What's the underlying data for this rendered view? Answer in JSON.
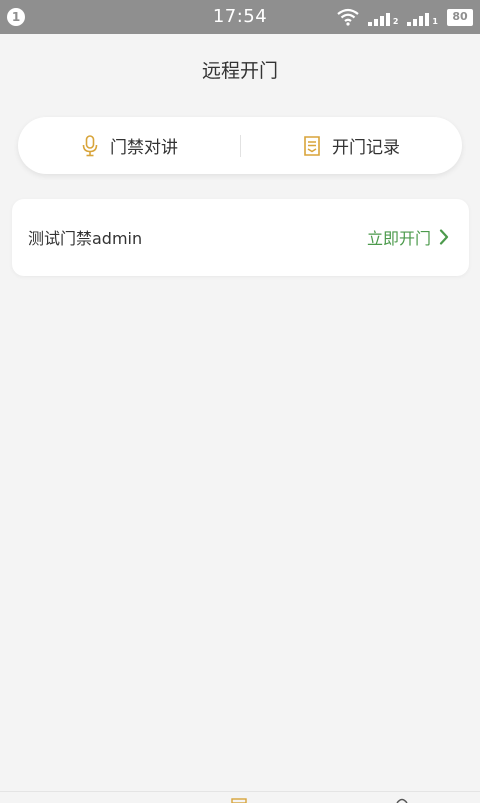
{
  "status_bar": {
    "notification_count": "1",
    "time": "17:54",
    "battery": "80",
    "icons": [
      "wifi-icon",
      "signal-icon",
      "signal-icon",
      "battery-icon"
    ]
  },
  "header": {
    "title": "远程开门"
  },
  "segment": {
    "intercom_label": "门禁对讲",
    "records_label": "开门记录",
    "intercom_icon": "microphone-icon",
    "records_icon": "document-icon"
  },
  "door": {
    "name": "测试门禁admin",
    "action_label": "立即开门",
    "action_icon": "chevron-right-icon"
  },
  "colors": {
    "accent_gold": "#d8a43a",
    "action_green": "#4c9a4c",
    "status_bar": "#8f8f8f",
    "background": "#f4f4f4"
  }
}
